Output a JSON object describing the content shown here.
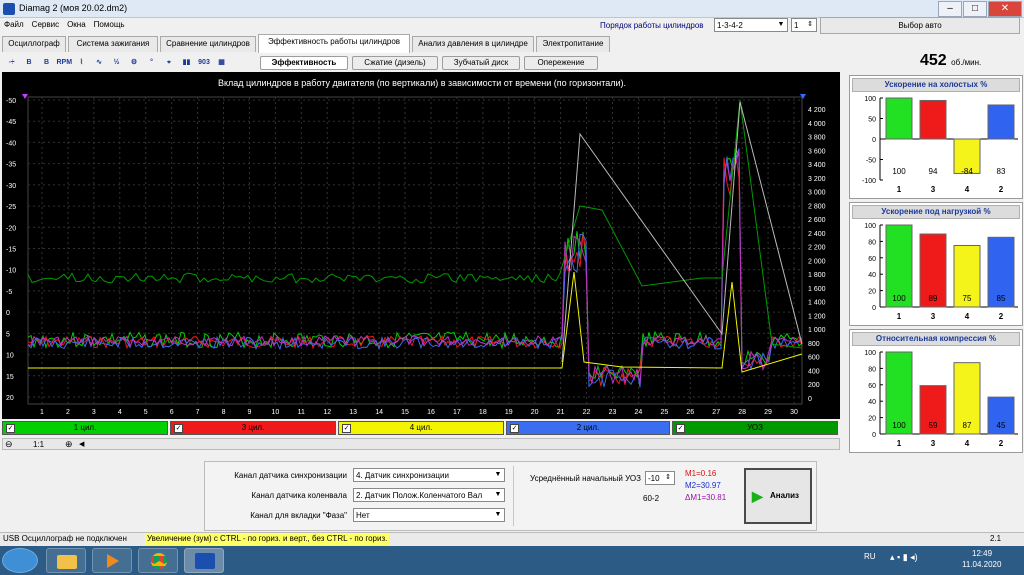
{
  "window": {
    "title": "Diamag 2 (моя 20.02.dm2)",
    "min": "–",
    "max": "□",
    "close": "✕"
  },
  "menu": [
    "Файл",
    "Сервис",
    "Окна",
    "Помощь"
  ],
  "cylinder_order": {
    "label": "Порядок работы цилиндров",
    "value": "1-3-4-2",
    "index": "1"
  },
  "auto_button": "Выбор авто",
  "tabs": [
    "Осциллограф",
    "Система зажигания",
    "Сравнение цилиндров",
    "Эффективность работы цилиндров",
    "Анализ давления в цилиндре",
    "Электропитание"
  ],
  "subtabs": [
    "Эффективность",
    "Сжатие (дизель)",
    "Зубчатый диск",
    "Опережение"
  ],
  "toolbar_icons": [
    "zoom-vertical-icon",
    "bold-b-icon",
    "cursor-b-icon",
    "rpm-icon",
    "graph-axis-icon",
    "curve-icon",
    "half-icon",
    "filter-icon",
    "angle-icon",
    "marker-icon",
    "bar-chart-icon",
    "camshaft-icon",
    "table-icon"
  ],
  "toolbar_labels": [
    "◦÷",
    "B",
    "B",
    "RPM",
    "⌇",
    "∿",
    "½",
    "⚙",
    "°",
    "⌖",
    "▮▮",
    "903",
    "▦"
  ],
  "rpm": {
    "value": "452",
    "unit": "об./мин."
  },
  "chart": {
    "title": "Вклад цилиндров в работу двигателя (по вертикали) в зависимости от времени (по горизонтали).",
    "left_ticks": [
      "-50",
      "-45",
      "-40",
      "-35",
      "-30",
      "-25",
      "-20",
      "-15",
      "-10",
      "-5",
      "0",
      "5",
      "10",
      "15",
      "20"
    ],
    "right_ticks": [
      "4 200",
      "4 000",
      "3 800",
      "3 600",
      "3 400",
      "3 200",
      "3 000",
      "2 800",
      "2 600",
      "2 400",
      "2 200",
      "2 000",
      "1 800",
      "1 600",
      "1 400",
      "1 200",
      "1 000",
      "800",
      "600",
      "400",
      "200",
      "0"
    ],
    "x_ticks": [
      "1",
      "2",
      "3",
      "4",
      "5",
      "6",
      "7",
      "8",
      "9",
      "10",
      "11",
      "12",
      "13",
      "14",
      "15",
      "16",
      "17",
      "18",
      "19",
      "20",
      "21",
      "22",
      "23",
      "24",
      "25",
      "26",
      "27",
      "28",
      "29",
      "30"
    ]
  },
  "channels": [
    {
      "label": "1 цил.",
      "color": "#00d000",
      "check": "✓"
    },
    {
      "label": "3 цил.",
      "color": "#f01818",
      "check": "✓"
    },
    {
      "label": "4 цил.",
      "color": "#f4f400",
      "check": "✓"
    },
    {
      "label": "2 цил.",
      "color": "#3a6ef0",
      "check": "✓"
    },
    {
      "label": "УОЗ",
      "color": "#009a00",
      "check": "✓"
    }
  ],
  "zoom": {
    "minus": "⊖",
    "value": "1:1",
    "plus": "⊕",
    "arrow": "◀"
  },
  "panels": [
    {
      "title": "Ускорение на холостых %",
      "ticks": [
        "100",
        "50",
        "0",
        "-50",
        "-100"
      ],
      "values": [
        100,
        94,
        -84,
        83
      ],
      "labels": [
        "100",
        "94",
        "-84",
        "83"
      ],
      "cyl": [
        "1",
        "3",
        "4",
        "2"
      ]
    },
    {
      "title": "Ускорение под нагрузкой %",
      "ticks": [
        "100",
        "80",
        "60",
        "40",
        "20",
        "0"
      ],
      "values": [
        100,
        89,
        75,
        85
      ],
      "labels": [
        "100",
        "89",
        "75",
        "85"
      ],
      "cyl": [
        "1",
        "3",
        "4",
        "2"
      ]
    },
    {
      "title": "Относительная компрессия %",
      "ticks": [
        "100",
        "80",
        "60",
        "40",
        "20",
        "0"
      ],
      "values": [
        100,
        59,
        87,
        45
      ],
      "labels": [
        "100",
        "59",
        "87",
        "45"
      ],
      "cyl": [
        "1",
        "3",
        "4",
        "2"
      ]
    }
  ],
  "bar_colors": [
    "#22e022",
    "#ef1a1a",
    "#f4f41a",
    "#2f63f0"
  ],
  "settings": {
    "sync_label": "Канал датчика синхронизации",
    "sync_value": "4. Датчик синхронизации",
    "crank_label": "Канал датчика коленвала",
    "crank_value": "2. Датчик Полож.Коленчатого Вал",
    "phase_label": "Канал для вкладки \"Фаза\"",
    "phase_value": "Нет",
    "uoz_label": "Усреднённый начальный УОЗ",
    "uoz_value": "-10",
    "disk": "60-2",
    "m1": "M1=0.16",
    "m2": "M2=30.97",
    "dm": "ΔM1=30.81",
    "analyze": "Анализ"
  },
  "status": {
    "left": "USB Осциллограф не подключен",
    "hint": "Увеличение (зум) с CTRL - по гориз. и верт., без CTRL - по гориз.",
    "right": "2.1"
  },
  "taskbar": {
    "lang": "RU",
    "time": "12:49",
    "date": "11.04.2020"
  }
}
